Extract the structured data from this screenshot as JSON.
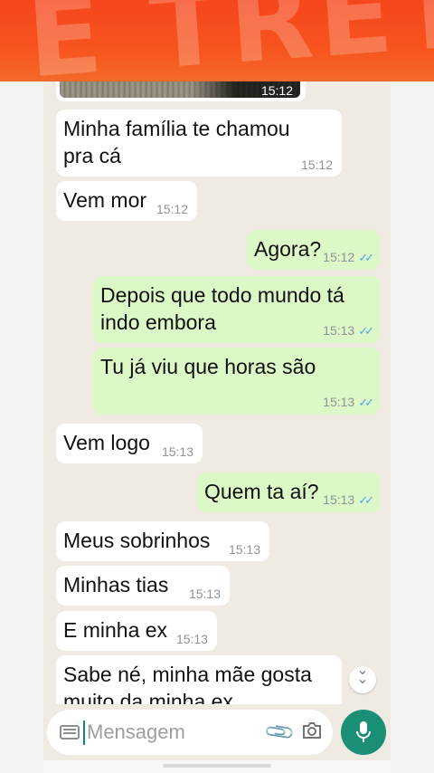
{
  "banner": {
    "text": "É TRETA"
  },
  "image_message": {
    "time": "15:12"
  },
  "messages": [
    {
      "dir": "in",
      "lines": [
        "Minha família te chamou",
        "pra cá"
      ],
      "time": "15:12"
    },
    {
      "dir": "in",
      "lines": [
        "Vem mor"
      ],
      "time": "15:12"
    },
    {
      "dir": "out",
      "lines": [
        "Agora?"
      ],
      "time": "15:12",
      "read": true
    },
    {
      "dir": "out",
      "lines": [
        "Depois que todo mundo tá",
        "indo embora"
      ],
      "time": "15:13",
      "read": true
    },
    {
      "dir": "out",
      "lines": [
        "Tu já viu que horas são"
      ],
      "time": "15:13",
      "read": true
    },
    {
      "dir": "in",
      "lines": [
        "Vem logo"
      ],
      "time": "15:13"
    },
    {
      "dir": "out",
      "lines": [
        "Quem ta aí?"
      ],
      "time": "15:13",
      "read": true
    },
    {
      "dir": "in",
      "lines": [
        "Meus sobrinhos"
      ],
      "time": "15:13"
    },
    {
      "dir": "in",
      "lines": [
        "Minhas tias"
      ],
      "time": "15:13"
    },
    {
      "dir": "in",
      "lines": [
        "E minha ex"
      ],
      "time": "15:13"
    },
    {
      "dir": "in",
      "lines": [
        "Sabe né, minha mãe gosta",
        "muito da minha ex"
      ],
      "time": ""
    }
  ],
  "ticks": "✓✓",
  "scroll_down": {
    "icon": "double-chevron-down-icon",
    "glyph": "⌄"
  },
  "composer": {
    "placeholder": "Mensagem",
    "keyboard_icon": "keyboard-icon",
    "attach_icon": "paperclip-icon",
    "camera_icon": "camera-icon",
    "mic_icon": "microphone-icon",
    "accent": "#1a8f76"
  },
  "colors": {
    "incoming": "#ffffff",
    "outgoing": "#dcf8c6",
    "read_ticks": "#53a6e8",
    "banner": "#f6461c"
  }
}
